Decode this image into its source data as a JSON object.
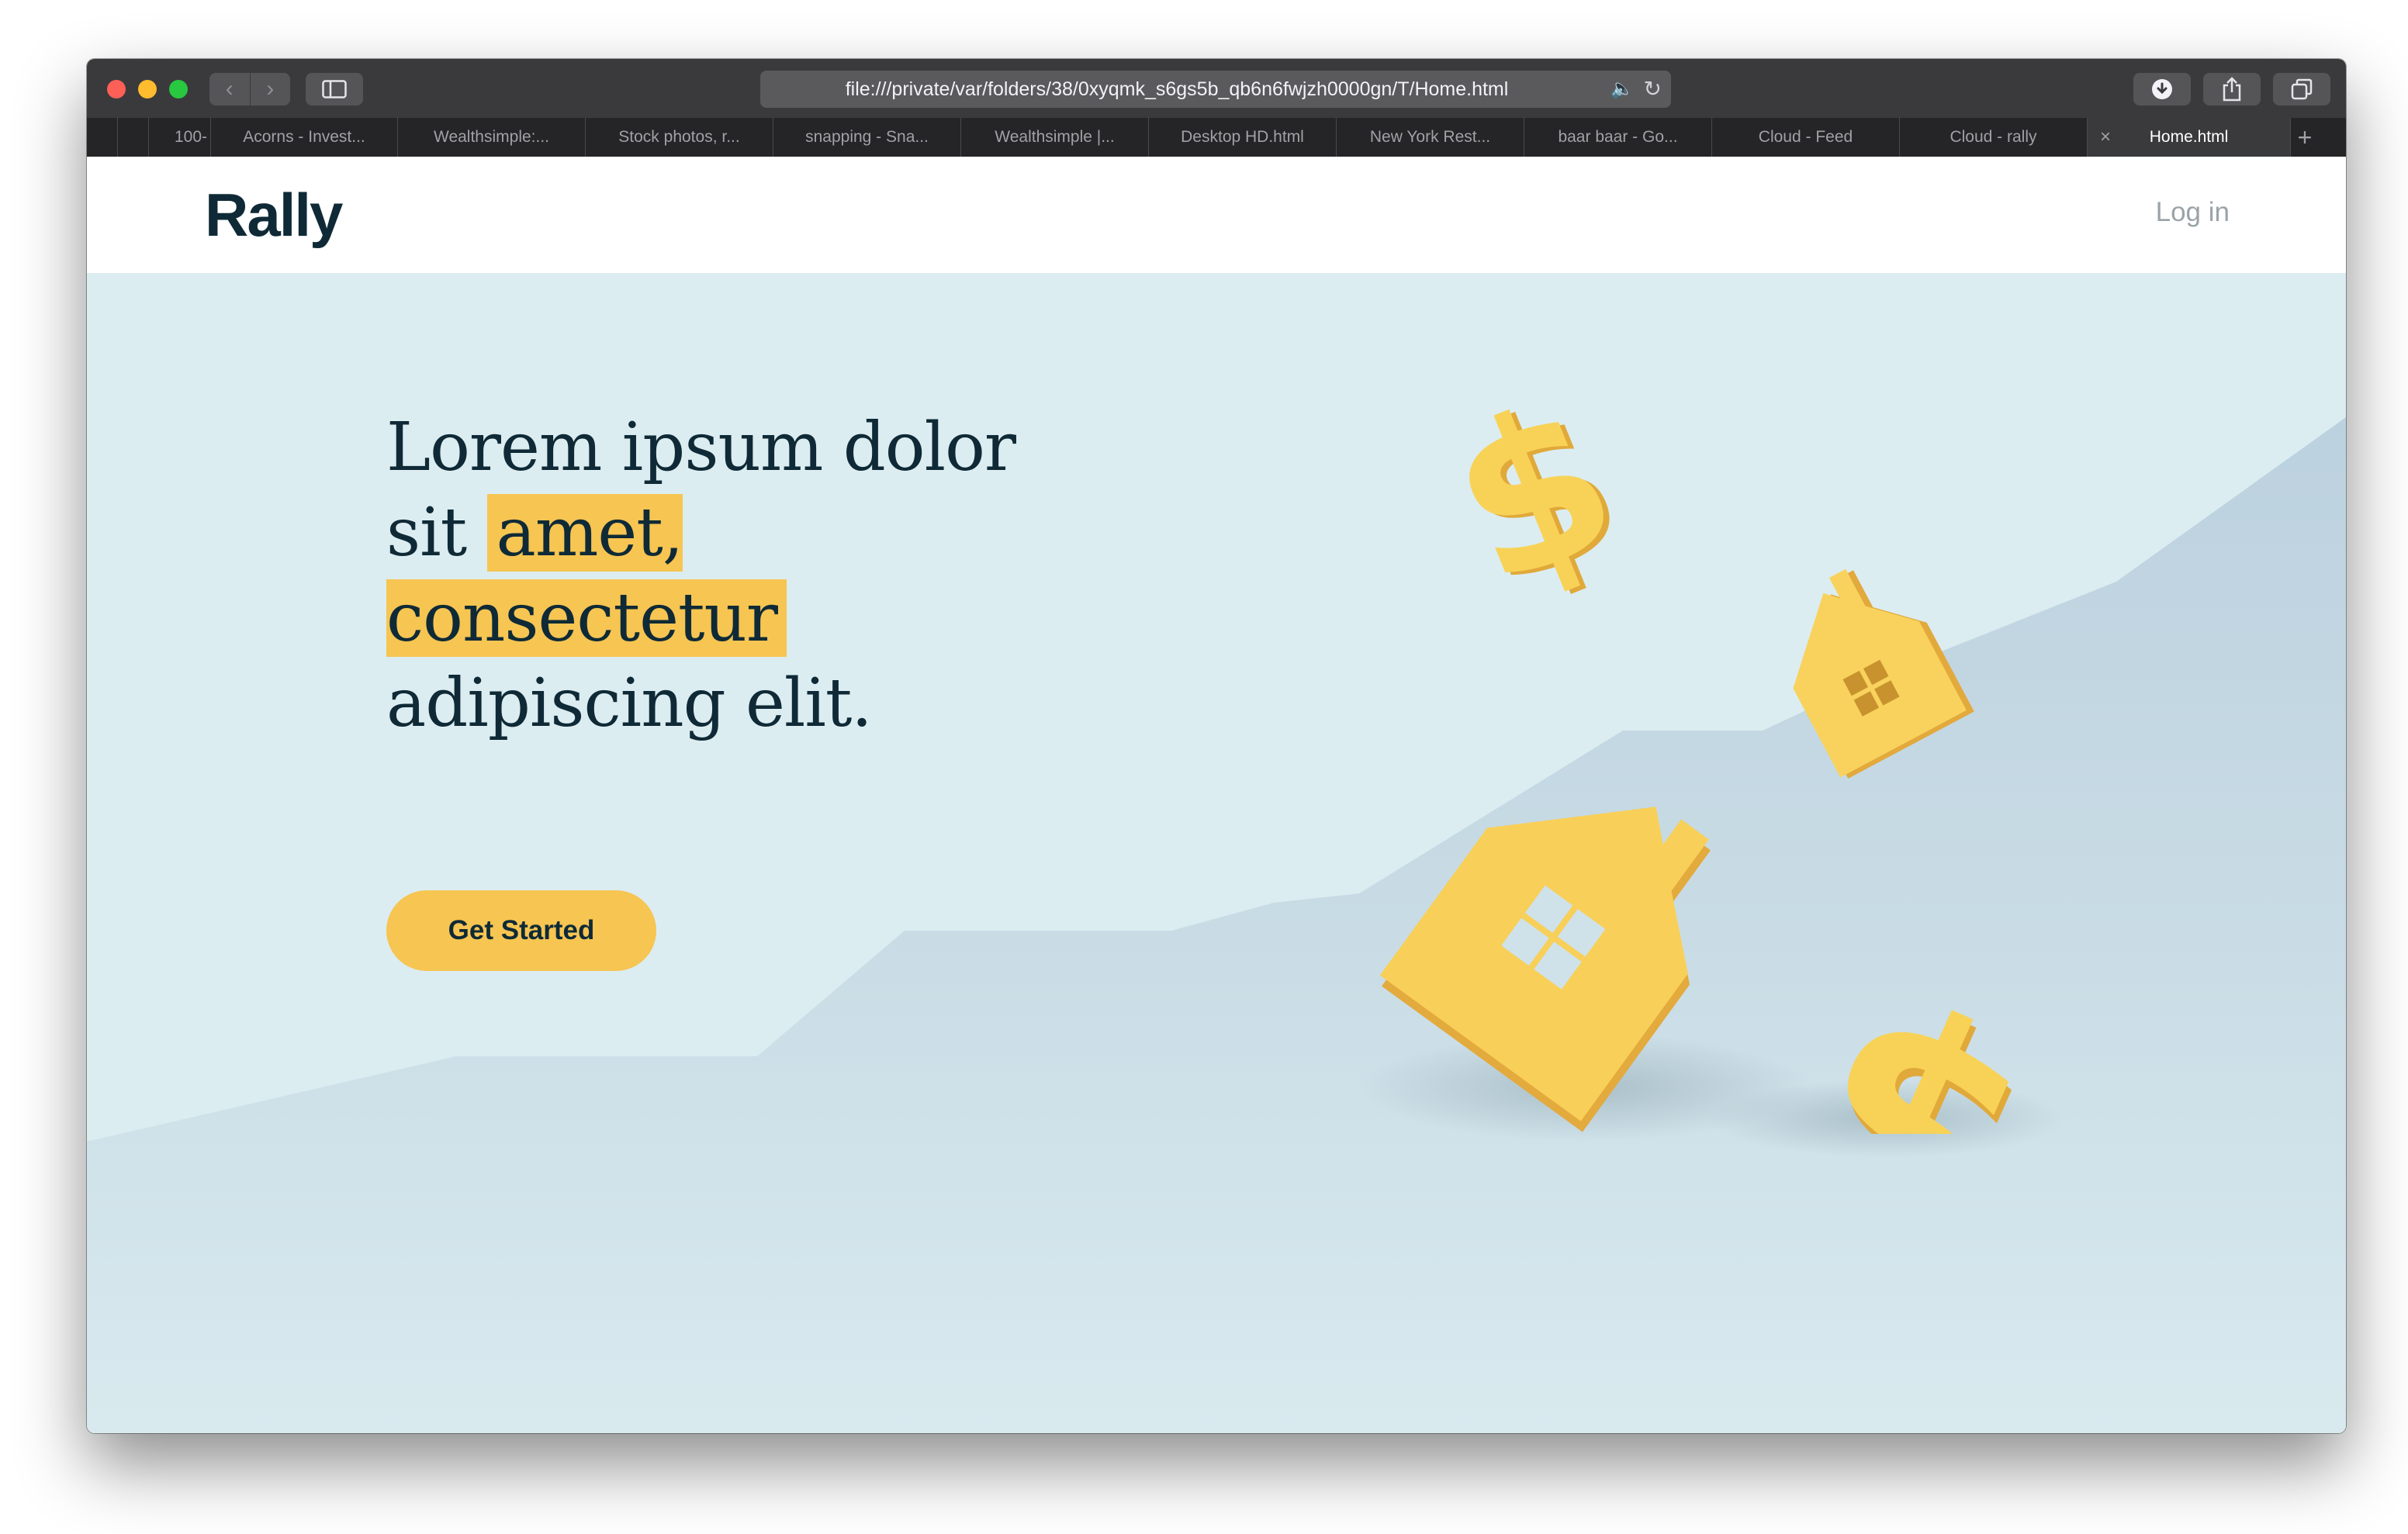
{
  "browser": {
    "url": "file:///private/var/folders/38/0xyqmk_s6gs5b_qb6n6fwjzh0000gn/T/Home.html",
    "tabs": [
      {
        "label": ""
      },
      {
        "label": "100-"
      },
      {
        "label": "Acorns - Invest..."
      },
      {
        "label": "Wealthsimple:..."
      },
      {
        "label": "Stock photos, r..."
      },
      {
        "label": "snapping - Sna..."
      },
      {
        "label": "Wealthsimple |..."
      },
      {
        "label": "Desktop HD.html"
      },
      {
        "label": "New York Rest..."
      },
      {
        "label": "baar baar - Go..."
      },
      {
        "label": "Cloud - Feed"
      },
      {
        "label": "Cloud - rally"
      },
      {
        "label": "Home.html"
      }
    ],
    "close_glyph": "×",
    "add_glyph": "+",
    "back_glyph": "‹",
    "forward_glyph": "›",
    "audio_glyph": "🔈",
    "reload_glyph": "↻",
    "icons": [
      "back-icon",
      "forward-icon",
      "sidebar-icon",
      "audio-icon",
      "reload-icon",
      "download-icon",
      "share-icon",
      "tabs-overview-icon"
    ]
  },
  "site": {
    "logo": "Rally",
    "login": "Log in"
  },
  "hero": {
    "title_part1": "Lorem ipsum dolor sit ",
    "title_highlight": "amet, consectetur",
    "title_part2": " adipiscing elit.",
    "cta": "Get Started"
  },
  "colors": {
    "accent": "#f6c552",
    "text": "#0f2a36",
    "background": "#dcedf1",
    "chart_fill": "#c9dde7"
  }
}
